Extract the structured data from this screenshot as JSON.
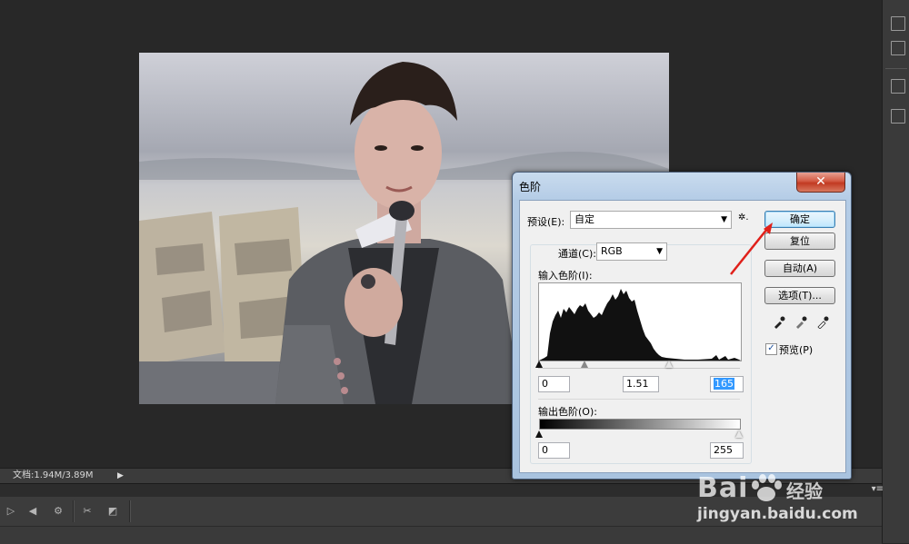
{
  "status_bar": {
    "doc_info": "文档:1.94M/3.89M"
  },
  "dialog": {
    "title": "色阶",
    "close_glyph": "✕",
    "preset_label": "预设(E):",
    "preset_value": "自定",
    "gear_glyph": "✲.",
    "channel_label": "通道(C):",
    "channel_value": "RGB",
    "input_levels_label": "输入色阶(I):",
    "input_levels": {
      "black": "0",
      "gamma": "1.51",
      "white": "165"
    },
    "output_levels_label": "输出色阶(O):",
    "output_levels": {
      "black": "0",
      "white": "255"
    },
    "buttons": {
      "ok": "确定",
      "reset": "复位",
      "auto": "自动(A)",
      "options": "选项(T)..."
    },
    "preview_label": "预览(P)",
    "preview_checked": true
  },
  "watermark": {
    "logo": "Bai",
    "logo_sub": "经验",
    "url": "jingyan.baidu.com"
  },
  "colors": {
    "workspace": "#282828",
    "accent_blue": "#3399ff",
    "arrow_red": "#e0201a"
  },
  "icons": {
    "close": "close-icon",
    "gear": "gear-icon",
    "dropdown": "chevron-down-icon",
    "eyedroppers": [
      "black-eyedropper-icon",
      "gray-eyedropper-icon",
      "white-eyedropper-icon"
    ]
  }
}
